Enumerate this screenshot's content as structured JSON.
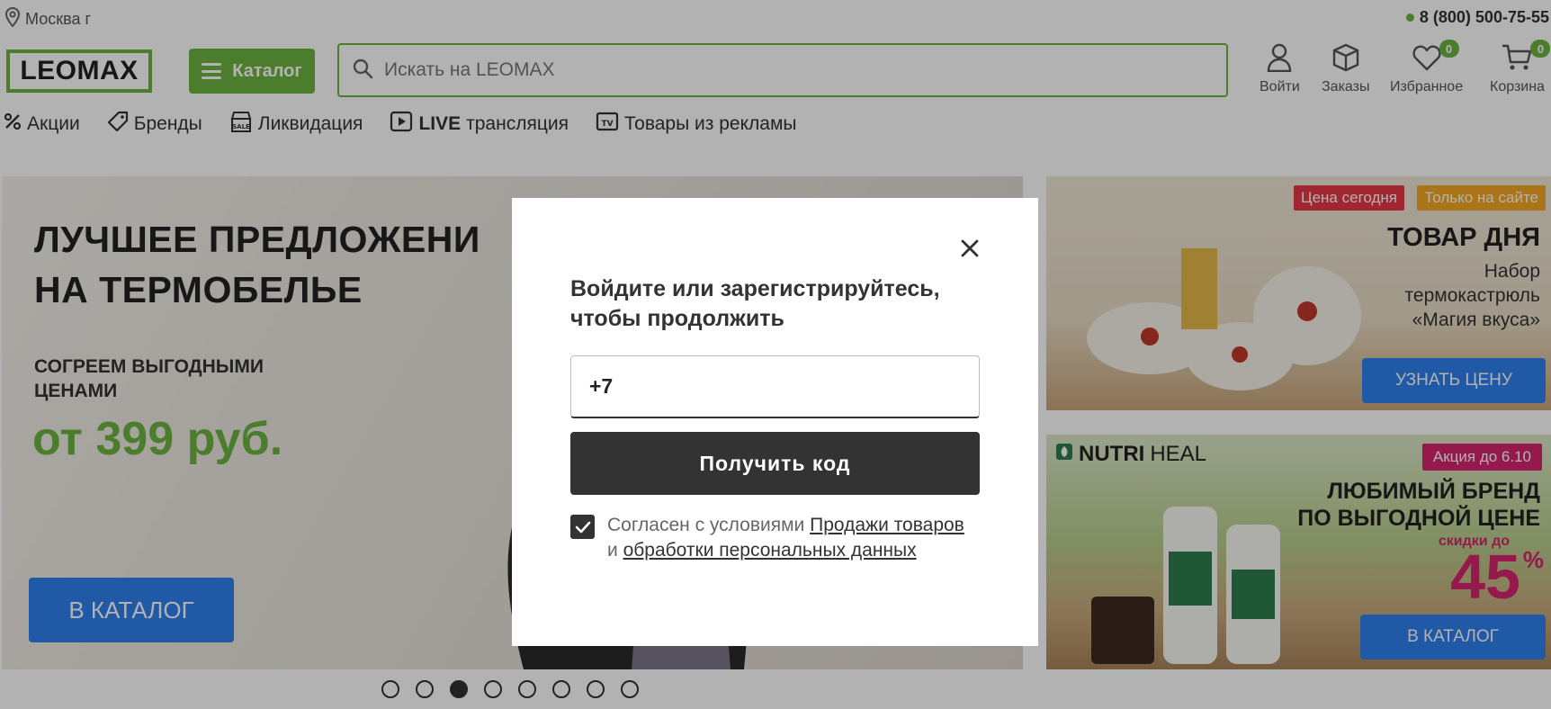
{
  "header": {
    "city": "Москва г",
    "phone": "8 (800) 500-75-55",
    "logo": "LEOMAX",
    "catalog_label": "Каталог",
    "search_placeholder": "Искать на LEOMAX",
    "actions": {
      "login": "Войти",
      "orders": "Заказы",
      "favorites": "Избранное",
      "favorites_count": "0",
      "cart": "Корзина",
      "cart_count": "0"
    }
  },
  "nav": {
    "promo": "Акции",
    "brands": "Бренды",
    "clearance": "Ликвидация",
    "live_bold": "LIVE",
    "live_rest": "трансляция",
    "tv": "Товары из рекламы"
  },
  "hero": {
    "title_line1": "ЛУЧШЕЕ ПРЕДЛОЖЕНИ",
    "title_line2": "НА ТЕРМОБЕЛЬЕ",
    "subtitle": "СОГРЕЕМ ВЫГОДНЫМИ ЦЕНАМИ",
    "price": "от 399 руб.",
    "button": "В КАТАЛОГ"
  },
  "side_banner_1": {
    "tag_today": "Цена сегодня",
    "tag_site": "Только на сайте",
    "title": "ТОВАР ДНЯ",
    "subtitle_line1": "Набор",
    "subtitle_line2": "термокастрюль",
    "subtitle_line3": "«Магия вкуса»",
    "button": "УЗНАТЬ ЦЕНУ"
  },
  "side_banner_2": {
    "brand_bold": "NUTRI",
    "brand_rest": "HEAL",
    "tag": "Акция до 6.10",
    "title_line1": "ЛЮБИМЫЙ БРЕНД",
    "title_line2": "ПО ВЫГОДНОЙ ЦЕНЕ",
    "discount_label": "скидки до",
    "discount_value": "45",
    "discount_unit": "%",
    "button": "В КАТАЛОГ"
  },
  "carousel": {
    "count": 8,
    "active_index": 2
  },
  "modal": {
    "title": "Войдите или зарегистрируйтесь, чтобы продолжить",
    "phone_value": "+7",
    "submit": "Получить код",
    "consent_prefix": "Согласен с условиями",
    "consent_link1": "Продажи товаров",
    "consent_and": "и",
    "consent_link2": "обработки персональных данных",
    "consent_checked": true
  },
  "colors": {
    "brand_green": "#6cb33f",
    "button_blue": "#2f80ed",
    "promo_pink": "#d6246e",
    "modal_button": "#333333"
  }
}
